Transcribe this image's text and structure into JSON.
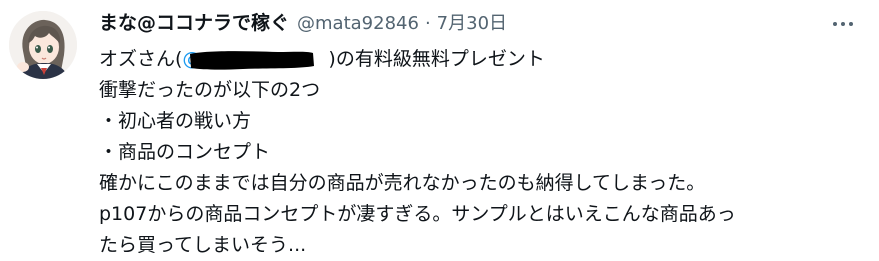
{
  "tweet": {
    "display_name": "まな@ココナラで稼ぐ",
    "handle": "@mata92846",
    "separator": "·",
    "date": "7月30日",
    "body": {
      "line1_pre": "オズさん(",
      "line1_mention": "@",
      "line1_post": ")の有料級無料プレゼント",
      "line2": "衝撃だったのが以下の2つ",
      "line3": "・初心者の戦い方",
      "line4": "・商品のコンセプト",
      "line5": "確かにこのままでは自分の商品が売れなかったのも納得してしまった。",
      "line6": "p107からの商品コンセプトが凄すぎる。サンプルとはいえこんな商品あっ",
      "line7": "たら買ってしまいそう..."
    }
  },
  "colors": {
    "text_primary": "#0f1419",
    "text_secondary": "#536471",
    "mention_blue": "#1d9bf0",
    "redaction": "#000000"
  },
  "icons": {
    "more": "more-horizontal-icon"
  }
}
